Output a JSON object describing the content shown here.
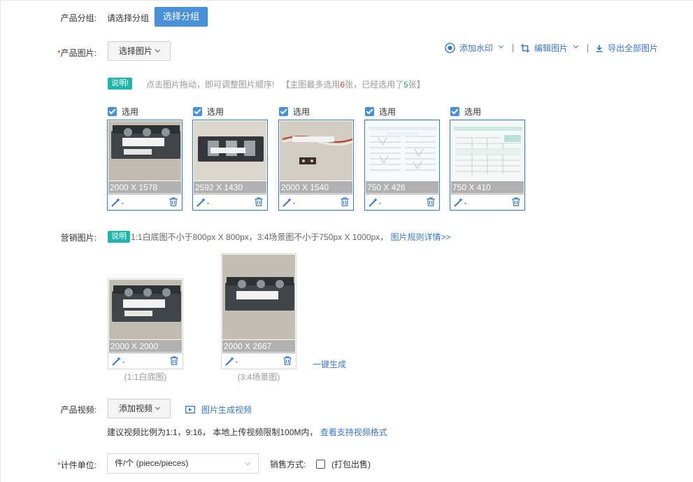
{
  "group": {
    "label": "产品分组:",
    "placeholder_text": "请选择分组",
    "button": "选择分组"
  },
  "product_images": {
    "required_mark": "*",
    "label": "产品图片:",
    "select_button": "选择图片",
    "toolbar": {
      "watermark": "添加水印",
      "edit": "编辑图片",
      "export": "导出全部图片"
    },
    "notice": {
      "tag": "说明!",
      "text_a": "点击图片拖动，即可调整图片顺序!",
      "text_b": "【主图最多选用",
      "max": "6",
      "text_c": "张，已经选用了",
      "used": "5",
      "text_d": "张】"
    },
    "checkbox_label": "选用",
    "items": [
      {
        "size": "2000 X 1578"
      },
      {
        "size": "2592 X 1430"
      },
      {
        "size": "2000 X 1540"
      },
      {
        "size": "750 X 426"
      },
      {
        "size": "750 X 410"
      }
    ]
  },
  "marketing": {
    "label": "营销图片:",
    "tag": "说明",
    "text": "1:1白底图不小于800px X 800px，3:4场景图不小于750px X 1000px，",
    "rules_link": "图片规则详情>>",
    "items": [
      {
        "size": "2000 X 2000",
        "caption": "(1:1白底图)"
      },
      {
        "size": "2000 X 2667",
        "caption": "(3:4场景图)"
      }
    ],
    "generate_link": "一键生成"
  },
  "video": {
    "label": "产品视频:",
    "add_button": "添加视频",
    "generate_link": "图片生成视频",
    "hint": "建议视频比例为1:1，9:16， 本地上传视频限制100M内，",
    "formats_link": "查看支持视频格式"
  },
  "unit": {
    "required_mark": "*",
    "label": "计件单位:",
    "value": "件/个 (piece/pieces)",
    "sale_label": "销售方式:",
    "package_label": "(打包出售)"
  },
  "colors": {
    "accent": "#4a90d9",
    "link": "#3a78c3",
    "tag": "#1fb5ad",
    "required": "#e4393c",
    "max_count": "#e4393c",
    "used_count": "#2ea043"
  }
}
